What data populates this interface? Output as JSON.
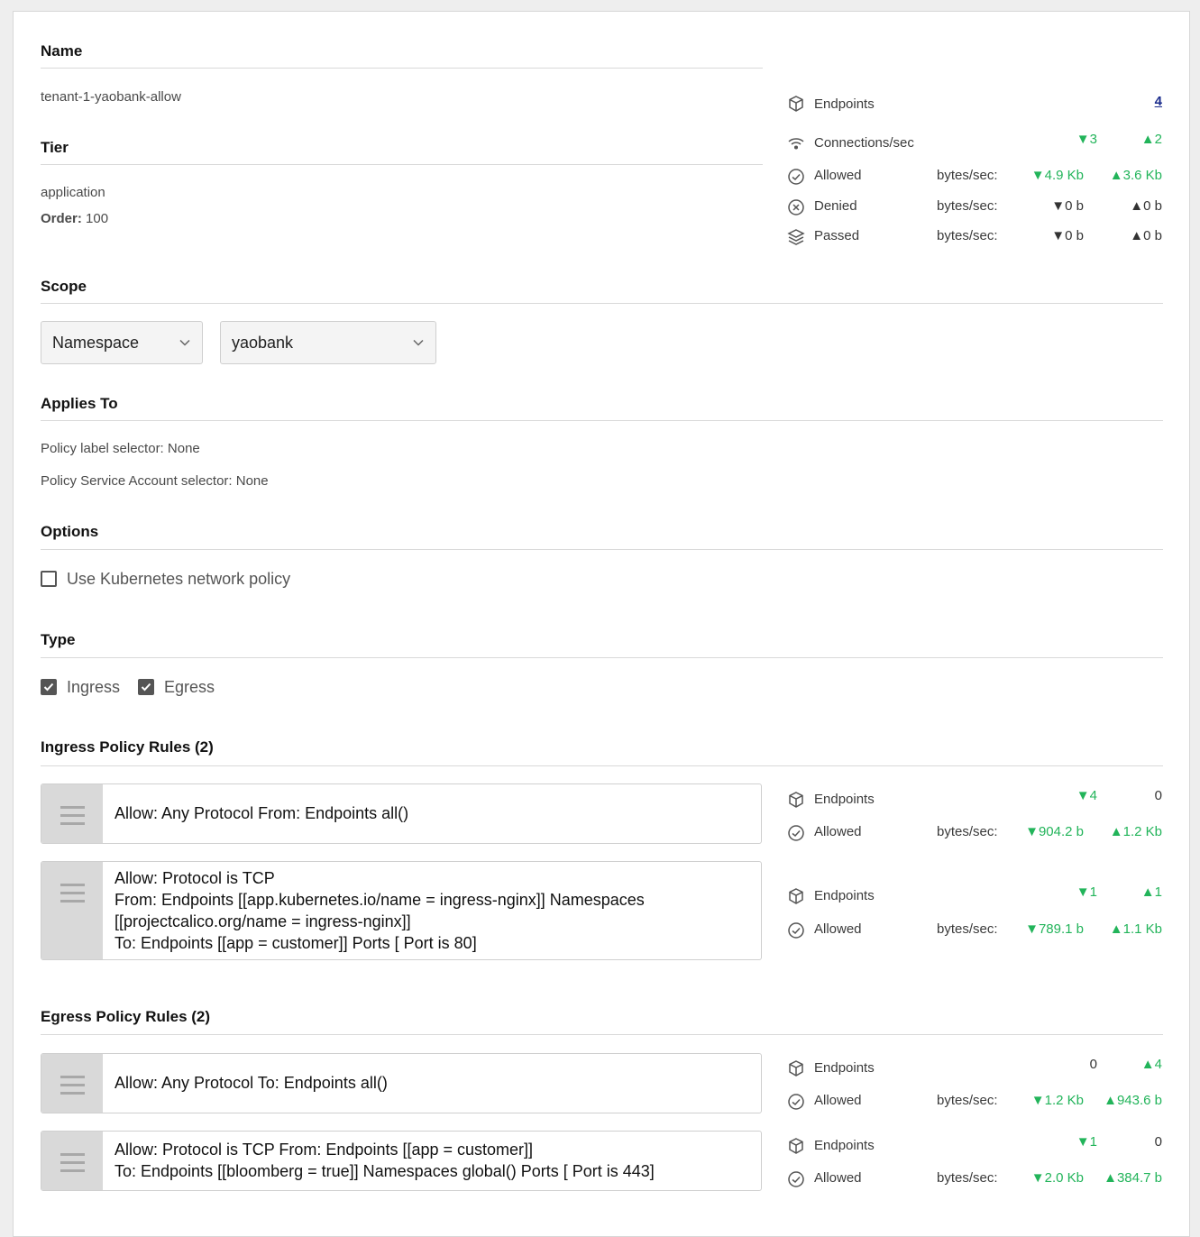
{
  "name": {
    "heading": "Name",
    "value": "tenant-1-yaobank-allow"
  },
  "tier": {
    "heading": "Tier",
    "value": "application",
    "order_label": "Order:",
    "order_value": "100"
  },
  "summary": {
    "endpoints": {
      "label": "Endpoints",
      "value": "4"
    },
    "connections": {
      "label": "Connections/sec",
      "down": "▼3",
      "up": "▲2"
    },
    "allowed": {
      "label": "Allowed",
      "unit": "bytes/sec:",
      "down": "▼4.9 Kb",
      "up": "▲3.6 Kb"
    },
    "denied": {
      "label": "Denied",
      "unit": "bytes/sec:",
      "down": "▼0 b",
      "up": "▲0 b"
    },
    "passed": {
      "label": "Passed",
      "unit": "bytes/sec:",
      "down": "▼0 b",
      "up": "▲0 b"
    }
  },
  "scope": {
    "heading": "Scope",
    "select1": "Namespace",
    "select2": "yaobank"
  },
  "applies_to": {
    "heading": "Applies To",
    "label_selector": "Policy label selector: None",
    "sa_selector": "Policy Service Account selector: None"
  },
  "options": {
    "heading": "Options",
    "k8s_label": "Use Kubernetes network policy",
    "k8s_checked": false
  },
  "type": {
    "heading": "Type",
    "ingress_label": "Ingress",
    "ingress_checked": true,
    "egress_label": "Egress",
    "egress_checked": true
  },
  "ingress": {
    "heading": "Ingress Policy Rules (2)",
    "rules": [
      {
        "lines": [
          "Allow:  Any Protocol  From:  Endpoints all()"
        ],
        "endpoints_label": "Endpoints",
        "endpoints_down": "▼4",
        "endpoints_up": "0",
        "allowed_label": "Allowed",
        "unit": "bytes/sec:",
        "bytes_down": "▼904.2 b",
        "bytes_up": "▲1.2 Kb"
      },
      {
        "lines": [
          "Allow:  Protocol is TCP",
          "From:  Endpoints [[app.kubernetes.io/name = ingress-nginx]]  Namespaces",
          "[[projectcalico.org/name = ingress-nginx]]",
          "To:  Endpoints [[app = customer]]  Ports [ Port is 80]"
        ],
        "endpoints_label": "Endpoints",
        "endpoints_down": "▼1",
        "endpoints_up": "▲1",
        "allowed_label": "Allowed",
        "unit": "bytes/sec:",
        "bytes_down": "▼789.1 b",
        "bytes_up": "▲1.1 Kb"
      }
    ]
  },
  "egress": {
    "heading": "Egress Policy Rules (2)",
    "rules": [
      {
        "lines": [
          "Allow:  Any Protocol  To:  Endpoints all()"
        ],
        "endpoints_label": "Endpoints",
        "endpoints_down": "0",
        "endpoints_up": "▲4",
        "allowed_label": "Allowed",
        "unit": "bytes/sec:",
        "bytes_down": "▼1.2 Kb",
        "bytes_up": "▲943.6 b"
      },
      {
        "lines": [
          "Allow:  Protocol is TCP  From:  Endpoints [[app = customer]]",
          "To:  Endpoints [[bloomberg = true]]  Namespaces global()  Ports [ Port is 443]"
        ],
        "endpoints_label": "Endpoints",
        "endpoints_down": "▼1",
        "endpoints_up": "0",
        "allowed_label": "Allowed",
        "unit": "bytes/sec:",
        "bytes_down": "▼2.0 Kb",
        "bytes_up": "▲384.7 b"
      }
    ]
  },
  "colors": {
    "positive": "#22b45a",
    "link": "#1a2b8c",
    "handle": "#d9d9d9"
  },
  "icons": {
    "endpoints": "cube-icon",
    "connections": "wifi-icon",
    "allowed": "check-circle-icon",
    "denied": "x-circle-icon",
    "passed": "layers-icon",
    "drag": "drag-handle-icon",
    "select": "chevron-down-icon"
  }
}
